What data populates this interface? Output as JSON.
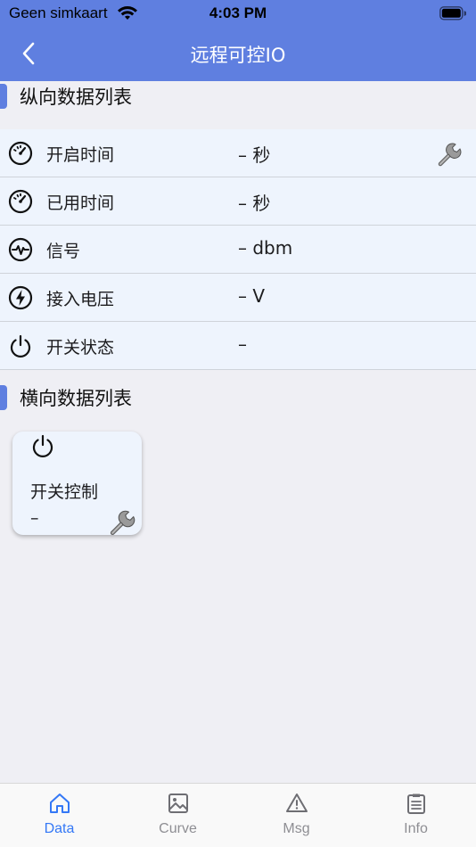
{
  "status_bar": {
    "carrier": "Geen simkaart",
    "time": "4:03 PM"
  },
  "nav": {
    "title": "远程可控IO",
    "back_icon": "chevron-left-icon"
  },
  "vertical_section": {
    "title": "纵向数据列表",
    "rows": [
      {
        "icon": "gauge-icon",
        "label": "开启时间",
        "value": "– 秒",
        "has_tool": true
      },
      {
        "icon": "gauge-icon",
        "label": "已用时间",
        "value": "– 秒",
        "has_tool": false
      },
      {
        "icon": "signal-pulse-icon",
        "label": "信号",
        "value": "– dbm",
        "has_tool": false
      },
      {
        "icon": "lightning-icon",
        "label": "接入电压",
        "value": "– V",
        "has_tool": false
      },
      {
        "icon": "power-icon",
        "label": "开关状态",
        "value": "–",
        "has_tool": false
      }
    ]
  },
  "horizontal_section": {
    "title": "横向数据列表",
    "cards": [
      {
        "icon": "power-icon",
        "label": "开关控制",
        "value": "–",
        "tool_icon": "wrench-icon"
      }
    ]
  },
  "tabs": [
    {
      "label": "Data",
      "icon": "house-icon",
      "active": true
    },
    {
      "label": "Curve",
      "icon": "image-icon",
      "active": false
    },
    {
      "label": "Msg",
      "icon": "warning-icon",
      "active": false
    },
    {
      "label": "Info",
      "icon": "clipboard-icon",
      "active": false
    }
  ],
  "colors": {
    "nav_bar": "#5f7fe0",
    "row_background": "#eef4fd",
    "page_background": "#efeff4",
    "tab_active": "#3478f6",
    "tab_inactive": "#8e8e93"
  }
}
